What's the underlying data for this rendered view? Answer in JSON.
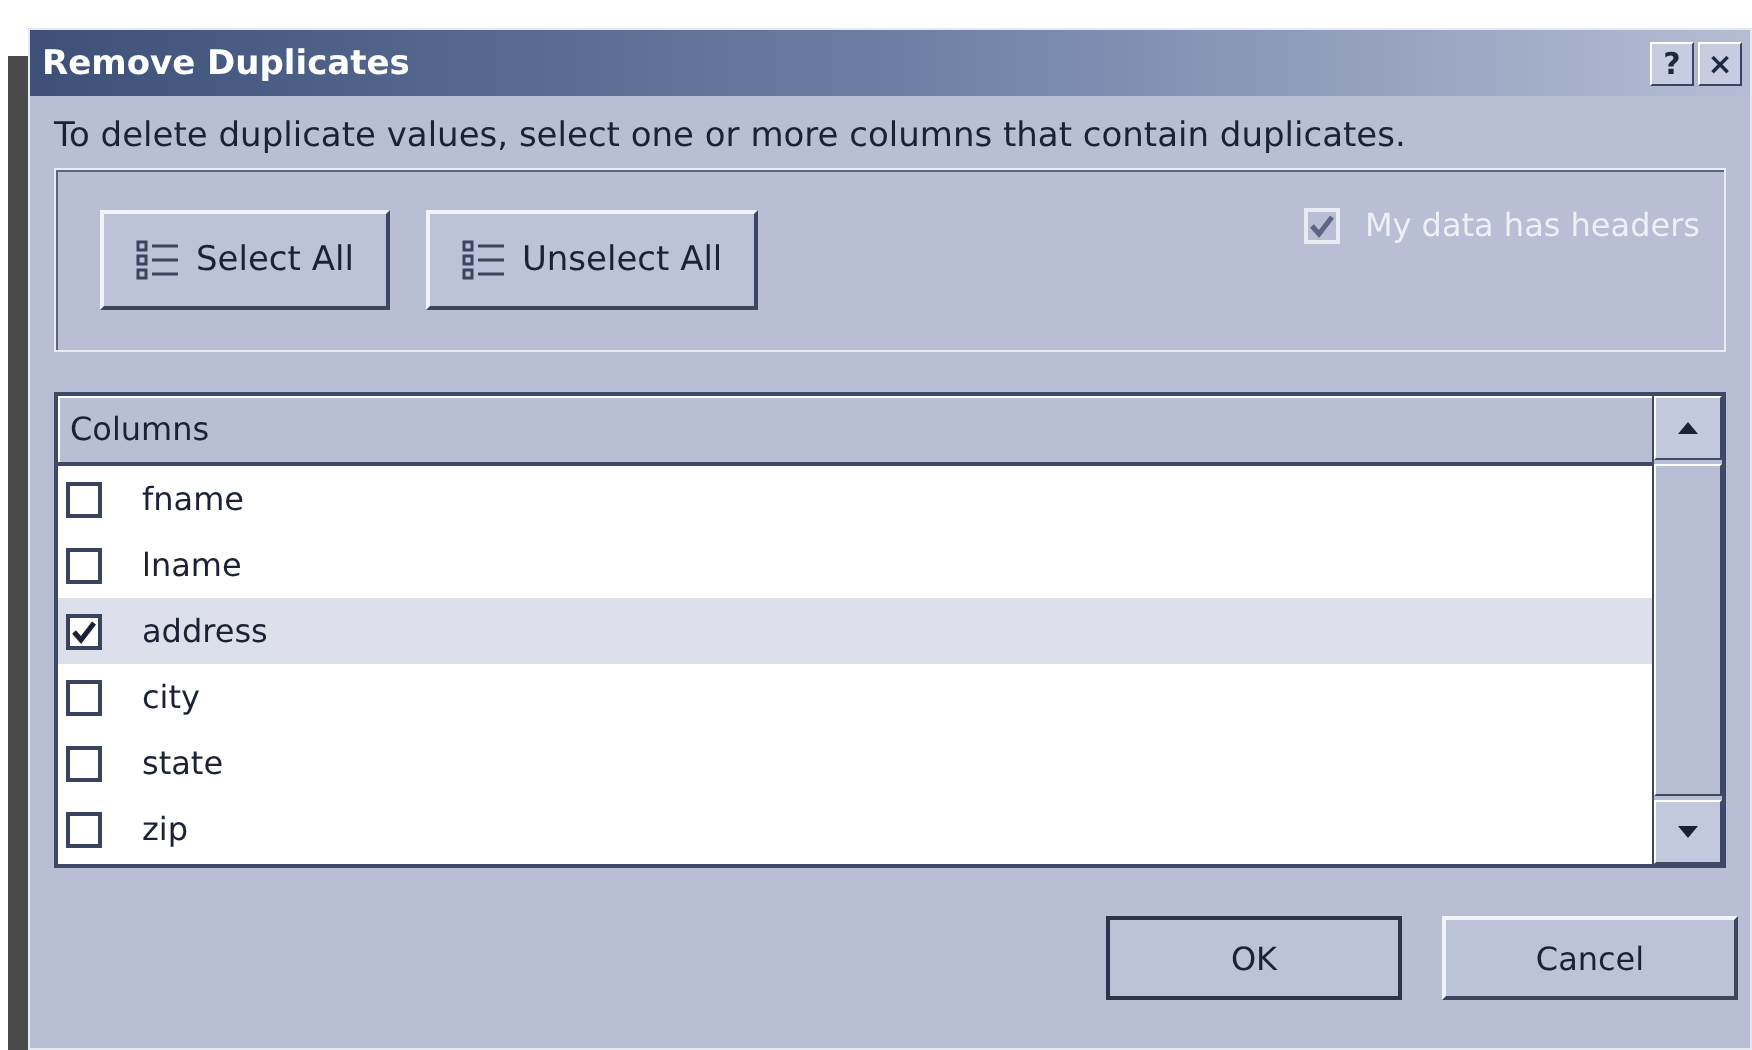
{
  "window": {
    "title": "Remove Duplicates",
    "title_buttons": [
      "?",
      "×"
    ]
  },
  "instruction": "To delete duplicate values, select one or more columns that contain duplicates.",
  "buttons_top": [
    {
      "label": "Select All"
    },
    {
      "label": "Unselect All"
    }
  ],
  "headers_option": {
    "label": "My data has headers",
    "checked": true,
    "disabled": true
  },
  "columns_list": {
    "header": "Columns",
    "rows": [
      {
        "name": "fname",
        "checked": false,
        "selected": false
      },
      {
        "name": "lname",
        "checked": false,
        "selected": false
      },
      {
        "name": "address",
        "checked": true,
        "selected": true
      },
      {
        "name": "city",
        "checked": false,
        "selected": false
      },
      {
        "name": "state",
        "checked": false,
        "selected": false
      },
      {
        "name": "zip",
        "checked": false,
        "selected": false
      }
    ]
  },
  "buttons": [
    "OK",
    "Cancel"
  ]
}
